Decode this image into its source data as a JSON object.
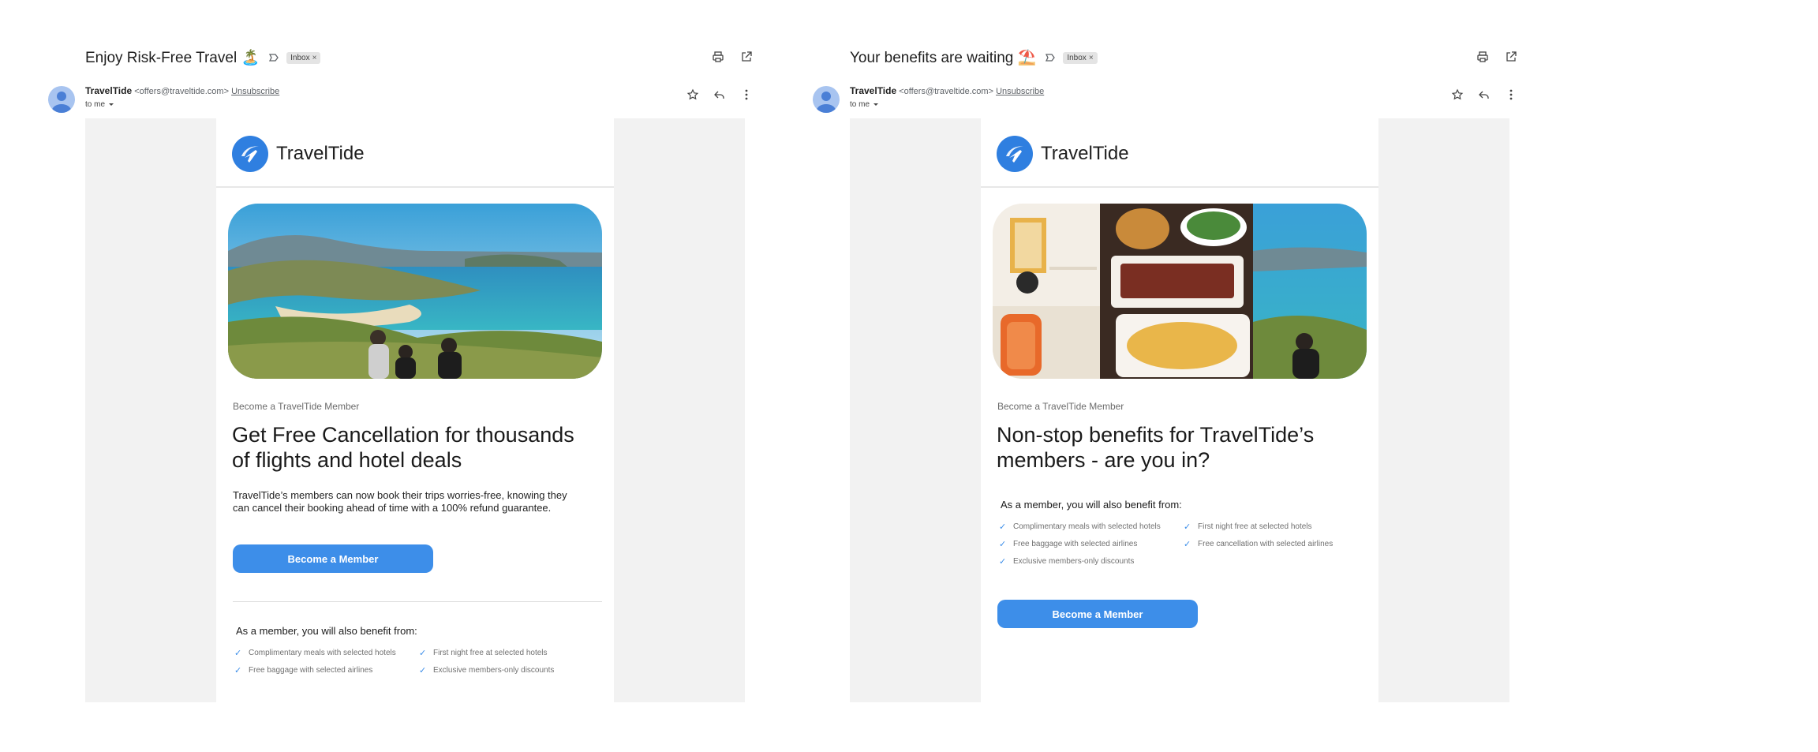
{
  "emails": [
    {
      "subject": "Enjoy Risk-Free Travel",
      "subject_emoji": "🏝️",
      "label": "Inbox",
      "sender_name": "TravelTide",
      "sender_email": "<offers@traveltide.com>",
      "unsubscribe": "Unsubscribe",
      "recipient": "to me",
      "brand": "TravelTide",
      "eyebrow": "Become a TravelTide Member",
      "headline": "Get Free Cancellation for thousands of flights and hotel deals",
      "body": "TravelTide’s members can now book their trips worries-free, knowing they can cancel their booking ahead of time with a 100% refund guarantee.",
      "cta": "Become a Member",
      "benefits_title": "As a member, you will also benefit from:",
      "benefits": [
        "Complimentary meals with selected hotels",
        "First night free at selected hotels",
        "Free baggage with selected airlines",
        "Exclusive members-only discounts"
      ]
    },
    {
      "subject": "Your benefits are waiting",
      "subject_emoji": "⛱️",
      "label": "Inbox",
      "sender_name": "TravelTide",
      "sender_email": "<offers@traveltide.com>",
      "unsubscribe": "Unsubscribe",
      "recipient": "to me",
      "brand": "TravelTide",
      "eyebrow": "Become a TravelTide Member",
      "headline": "Non-stop benefits for TravelTide’s members - are you in?",
      "cta": "Become a Member",
      "benefits_title": "As a member, you will also benefit from:",
      "benefits": [
        "Complimentary meals with selected hotels",
        "First night free at selected hotels",
        "Free baggage with selected airlines",
        "Free cancellation with selected airlines",
        "Exclusive members-only discounts"
      ]
    }
  ],
  "colors": {
    "accent": "#3d8ee9",
    "logo": "#2f7fe0",
    "frame": "#f2f2f2"
  },
  "icons": [
    "label-icon",
    "print-icon",
    "open-in-new-icon",
    "star-icon",
    "reply-icon",
    "more-vert-icon",
    "caret-down-icon",
    "check-icon",
    "plane-logo-icon"
  ]
}
